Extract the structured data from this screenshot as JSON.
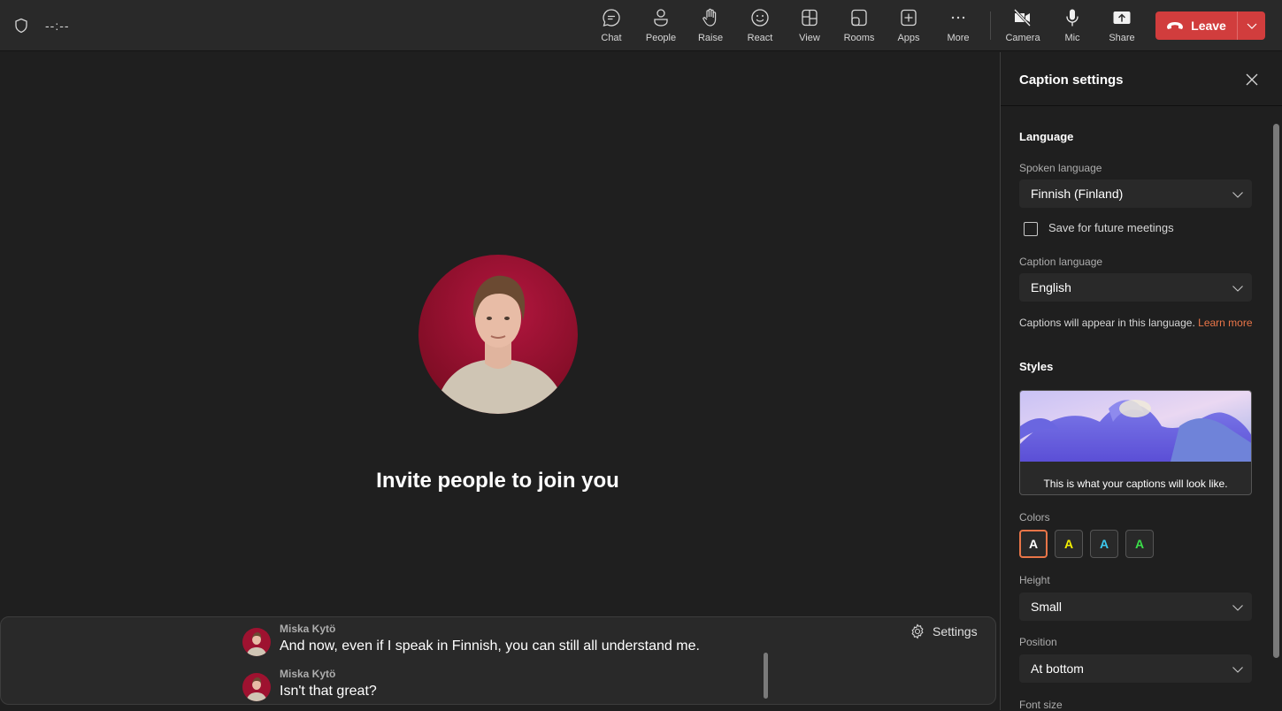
{
  "topbar": {
    "timer": "--:--",
    "buttons": [
      {
        "id": "chat",
        "label": "Chat",
        "icon": "chat-icon"
      },
      {
        "id": "people",
        "label": "People",
        "icon": "people-icon"
      },
      {
        "id": "raise",
        "label": "Raise",
        "icon": "hand-icon"
      },
      {
        "id": "react",
        "label": "React",
        "icon": "smiley-icon"
      },
      {
        "id": "view",
        "label": "View",
        "icon": "grid-icon"
      },
      {
        "id": "rooms",
        "label": "Rooms",
        "icon": "rooms-icon"
      },
      {
        "id": "apps",
        "label": "Apps",
        "icon": "plus-box-icon"
      },
      {
        "id": "more",
        "label": "More",
        "icon": "ellipsis-icon"
      },
      {
        "id": "camera",
        "label": "Camera",
        "icon": "camera-off-icon"
      },
      {
        "id": "mic",
        "label": "Mic",
        "icon": "mic-icon"
      },
      {
        "id": "share",
        "label": "Share",
        "icon": "share-icon"
      }
    ],
    "leave_label": "Leave",
    "leave_color": "#d13d3d"
  },
  "stage": {
    "invite_text": "Invite people to join you"
  },
  "captions": {
    "settings_label": "Settings",
    "lines": [
      {
        "speaker": "Miska Kytö",
        "text": "And now, even if I speak in Finnish, you can still all understand me."
      },
      {
        "speaker": "Miska Kytö",
        "text": "Isn't that great?"
      }
    ]
  },
  "panel": {
    "title": "Caption settings",
    "language_heading": "Language",
    "spoken_label": "Spoken language",
    "spoken_value": "Finnish (Finland)",
    "save_label": "Save for future meetings",
    "save_checked": false,
    "caption_label": "Caption language",
    "caption_value": "English",
    "help_text": "Captions will appear in this language.",
    "learn_more": "Learn more",
    "styles_heading": "Styles",
    "preview_text": "This is what your captions will look like.",
    "colors_label": "Colors",
    "colors": [
      {
        "letter": "A",
        "color": "#ffffff",
        "selected": true
      },
      {
        "letter": "A",
        "color": "#f3f000",
        "selected": false
      },
      {
        "letter": "A",
        "color": "#3cc9f0",
        "selected": false
      },
      {
        "letter": "A",
        "color": "#3be04a",
        "selected": false
      }
    ],
    "height_label": "Height",
    "height_value": "Small",
    "position_label": "Position",
    "position_value": "At bottom",
    "font_size_label": "Font size",
    "accent": "#e97548"
  }
}
